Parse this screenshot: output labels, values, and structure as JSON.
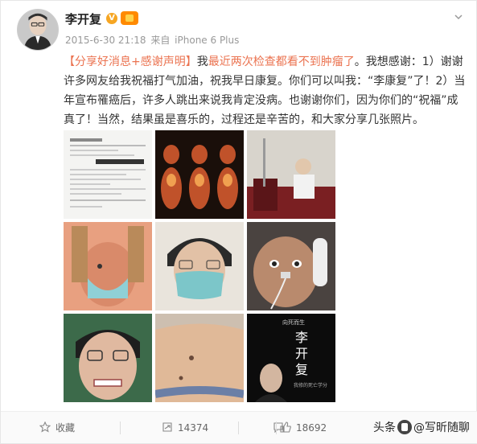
{
  "post": {
    "author": "李开复",
    "verified_badge": "V",
    "date": "2015-6-30 21:18",
    "source_prefix": "来自",
    "source_device": "iPhone 6 Plus",
    "content": {
      "topic": "【分享好消息+感谢声明】",
      "intro": "我",
      "highlight": "最近两次检查都看不到肿瘤了",
      "body": "。我想感谢：1）谢谢许多网友给我祝福打气加油，祝我早日康复。你们可以叫我：“李康复”了！2）当年宣布罹癌后，许多人跳出来说我肯定没病。也谢谢你们，因为你们的“祝福”成真了！当然，结果虽是喜乐的，过程还是辛苦的，和大家分享几张照片。"
    },
    "photos": [
      {
        "name": "photo-medical-report",
        "icon": "document"
      },
      {
        "name": "photo-pet-scans",
        "icon": "scan"
      },
      {
        "name": "photo-hospital-room",
        "icon": "room"
      },
      {
        "name": "photo-radiation-mask",
        "icon": "mask"
      },
      {
        "name": "photo-face-mask-selfie",
        "icon": "selfie"
      },
      {
        "name": "photo-nasal-tube",
        "icon": "tube"
      },
      {
        "name": "photo-grimace-face",
        "icon": "face"
      },
      {
        "name": "photo-abdomen",
        "icon": "abdomen"
      },
      {
        "name": "photo-book-cover",
        "icon": "book"
      }
    ],
    "book_cover": {
      "small_text": "向死而生",
      "title_chars": [
        "李",
        "开",
        "复"
      ],
      "side_text": "我修的死亡学分"
    }
  },
  "actions": {
    "favorite": "收藏",
    "repost": "14374",
    "comment": "",
    "like": "18692"
  },
  "watermark": {
    "prefix": "头条",
    "suffix": "@写昕随聊"
  },
  "colors": {
    "link": "#eb7350",
    "meta": "#999999",
    "verified": "#f6a623"
  }
}
